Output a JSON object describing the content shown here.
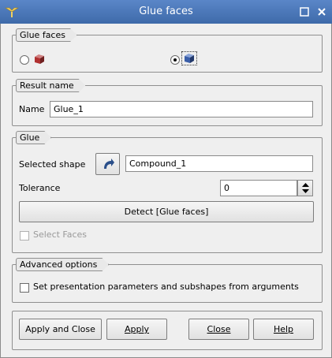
{
  "window": {
    "title": "Glue faces"
  },
  "glue_faces_group": {
    "title": "Glue faces",
    "option1": {
      "icon": "solid-cube-icon",
      "selected": false
    },
    "option2": {
      "icon": "solid-faces-cube-icon",
      "selected": true
    }
  },
  "result_group": {
    "title": "Result name",
    "name_label": "Name",
    "name_value": "Glue_1"
  },
  "glue_group": {
    "title": "Glue",
    "selected_shape_label": "Selected shape",
    "selected_shape_value": "Compound_1",
    "tolerance_label": "Tolerance",
    "tolerance_value": "0",
    "detect_button": "Detect [Glue faces]",
    "select_faces_label": "Select Faces",
    "select_faces_checked": false
  },
  "advanced_group": {
    "title": "Advanced options",
    "presentation_label": "Set presentation parameters and subshapes from arguments",
    "presentation_checked": false
  },
  "buttons": {
    "apply_close": "Apply and Close",
    "apply": "Apply",
    "close": "Close",
    "help": "Help"
  },
  "colors": {
    "titlebar": "#4a78bb",
    "window_bg": "#efefef"
  }
}
